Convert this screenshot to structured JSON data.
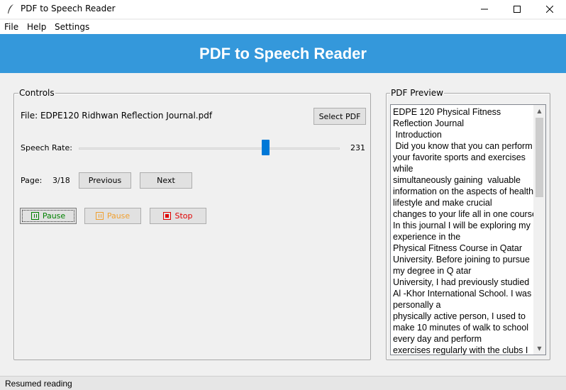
{
  "window": {
    "title": "PDF to Speech Reader"
  },
  "menu": {
    "items": [
      "File",
      "Help",
      "Settings"
    ]
  },
  "header": {
    "title": "PDF to Speech Reader",
    "bg_color": "#3498db"
  },
  "controls": {
    "legend": "Controls",
    "file_label": "File: EDPE120 Ridhwan Reflection Journal.pdf",
    "select_pdf_label": "Select PDF",
    "speech_rate_label": "Speech Rate:",
    "speech_rate_value": "231",
    "page_label": "Page:",
    "page_value": "3/18",
    "previous_label": "Previous",
    "next_label": "Next",
    "pause_label": "Pause",
    "pause2_label": "Pause",
    "stop_label": "Stop",
    "colors": {
      "pause": "#008000",
      "pause_disabled": "#f0a030",
      "stop": "#e00000",
      "slider": "#0078d7"
    }
  },
  "preview": {
    "legend": "PDF Preview",
    "lines": [
      "EDPE 120 Physical Fitness",
      "Reflection Journal",
      " Introduction",
      " Did you know that you can perform",
      "your favorite sports and exercises",
      "while",
      "simultaneously gaining  valuable",
      "information on the aspects of health",
      "lifestyle and make crucial",
      "changes to your life all in one course",
      "In this journal I will be exploring my",
      "experience in the",
      "Physical Fitness Course in Qatar",
      "University. Before joining to pursue",
      "my degree in Q atar",
      "University, I had previously studied",
      "Al -Khor International School. I was",
      "personally a",
      "physically active person, I used to",
      "make 10 minutes of walk to school",
      "every day and perform",
      "exercises regularly with the clubs I"
    ]
  },
  "status": {
    "text": "Resumed reading"
  }
}
